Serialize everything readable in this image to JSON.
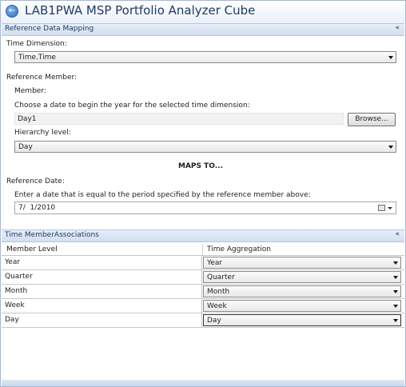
{
  "window": {
    "title": "LAB1PWA MSP Portfolio Analyzer Cube",
    "back_glyph": "←"
  },
  "reference_mapping": {
    "header": "Reference Data Mapping",
    "collapse_glyph": "«",
    "time_dimension_label": "Time Dimension:",
    "time_dimension_value": "Time.Time",
    "reference_member_label": "Reference Member:",
    "member_label": "Member:",
    "choose_date_label": "Choose a date to begin the year for the selected time dimension:",
    "member_value": "Day1",
    "browse_label": "Browse...",
    "hierarchy_label": "Hierarchy  level:",
    "hierarchy_value": "Day",
    "maps_to": "MAPS TO...",
    "reference_date_label": "Reference Date:",
    "enter_date_label": "Enter a date that is equal to the period specified by the reference member above:",
    "date_value": "7/  1/2010"
  },
  "associations": {
    "header": "Time MemberAssociations",
    "collapse_glyph": "«",
    "col_member_level": "Member Level",
    "col_time_aggregation": "Time Aggregation",
    "rows": [
      {
        "level": "Year",
        "aggregation": "Year"
      },
      {
        "level": "Quarter",
        "aggregation": "Quarter"
      },
      {
        "level": "Month",
        "aggregation": "Month"
      },
      {
        "level": "Week",
        "aggregation": "Week"
      },
      {
        "level": "Day",
        "aggregation": "Day"
      }
    ]
  },
  "icons": [
    "back-arrow-icon",
    "collapse-icon",
    "calendar-icon",
    "dropdown-arrow-icon"
  ]
}
